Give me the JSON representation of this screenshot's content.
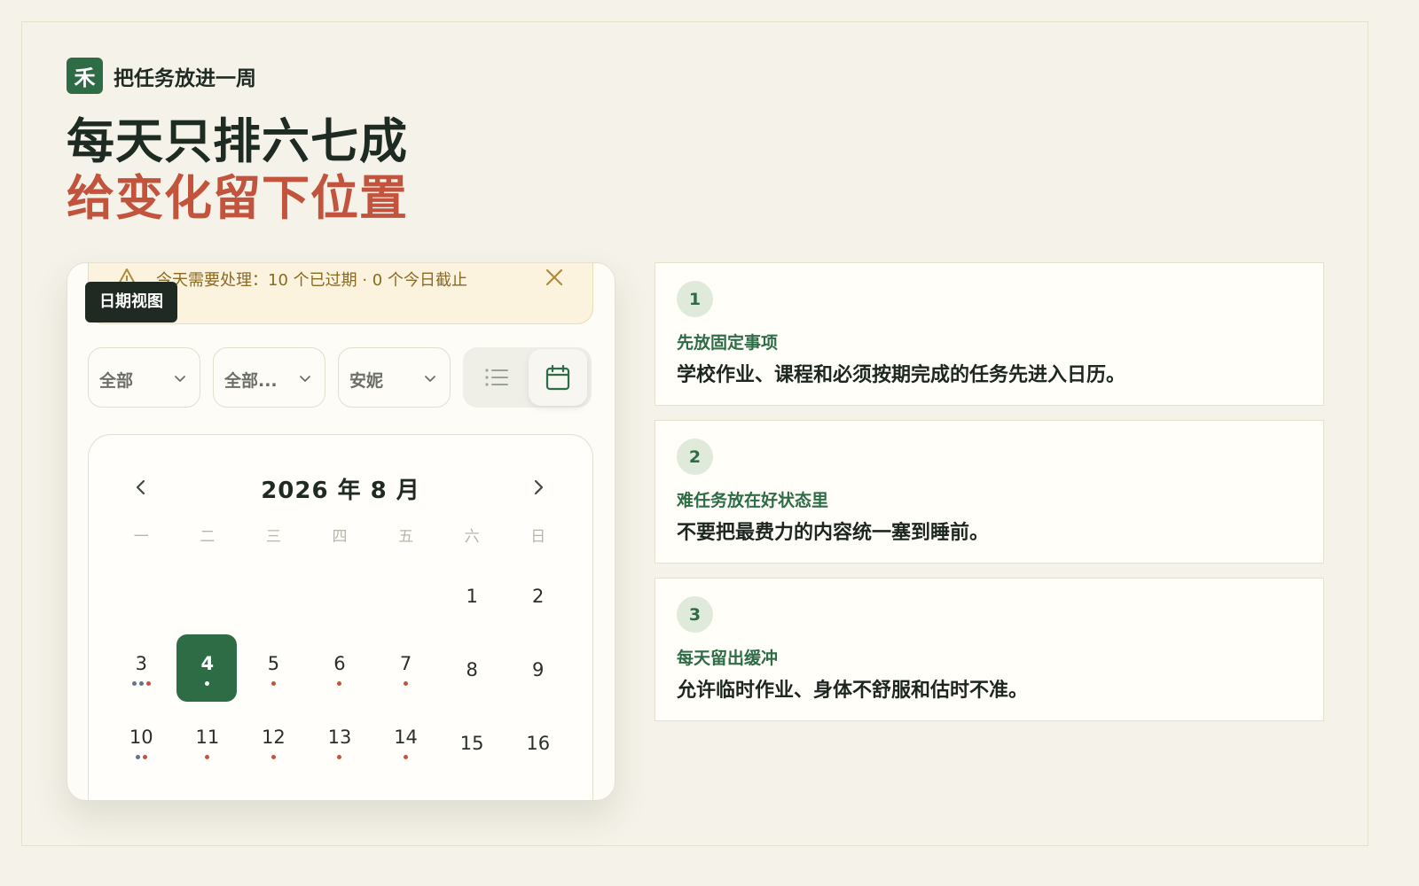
{
  "brand": {
    "logo_char": "禾",
    "name": "把任务放进一周"
  },
  "headline": {
    "line1": "每天只排六七成",
    "line2": "给变化留下位置"
  },
  "alert": {
    "text": "今天需要处理：10 个已过期 · 0 个今日截止"
  },
  "tooltip": {
    "text": "日期视图"
  },
  "filters": [
    {
      "value": "全部"
    },
    {
      "value": "全部..."
    },
    {
      "value": "安妮"
    }
  ],
  "calendar": {
    "title": "2026 年 8 月",
    "weekdays": [
      "一",
      "二",
      "三",
      "四",
      "五",
      "六",
      "日"
    ],
    "selected_day": "4",
    "days": [
      {
        "num": "",
        "dots": []
      },
      {
        "num": "",
        "dots": []
      },
      {
        "num": "",
        "dots": []
      },
      {
        "num": "",
        "dots": []
      },
      {
        "num": "",
        "dots": []
      },
      {
        "num": "1",
        "dots": []
      },
      {
        "num": "2",
        "dots": []
      },
      {
        "num": "3",
        "dots": [
          "blue",
          "blue",
          "red"
        ]
      },
      {
        "num": "4",
        "dots": [
          "red"
        ]
      },
      {
        "num": "5",
        "dots": [
          "red"
        ]
      },
      {
        "num": "6",
        "dots": [
          "red"
        ]
      },
      {
        "num": "7",
        "dots": [
          "red"
        ]
      },
      {
        "num": "8",
        "dots": []
      },
      {
        "num": "9",
        "dots": []
      },
      {
        "num": "10",
        "dots": [
          "blue",
          "red"
        ]
      },
      {
        "num": "11",
        "dots": [
          "red"
        ]
      },
      {
        "num": "12",
        "dots": [
          "red"
        ]
      },
      {
        "num": "13",
        "dots": [
          "red"
        ]
      },
      {
        "num": "14",
        "dots": [
          "red"
        ]
      },
      {
        "num": "15",
        "dots": []
      },
      {
        "num": "16",
        "dots": []
      }
    ]
  },
  "tips": [
    {
      "num": "1",
      "title": "先放固定事项",
      "desc": "学校作业、课程和必须按期完成的任务先进入日历。"
    },
    {
      "num": "2",
      "title": "难任务放在好状态里",
      "desc": "不要把最费力的内容统一塞到睡前。"
    },
    {
      "num": "3",
      "title": "每天留出缓冲",
      "desc": "允许临时作业、身体不舒服和估时不准。"
    }
  ],
  "colors": {
    "accent_green": "#2e6c46",
    "accent_red": "#c2543e",
    "background": "#f5f3e9"
  },
  "icons": {
    "alert": "warning-triangle-icon",
    "close": "close-icon",
    "list_view": "list-icon",
    "calendar_view": "calendar-icon",
    "prev": "chevron-left-icon",
    "next": "chevron-right-icon",
    "dropdown": "chevron-down-icon"
  }
}
